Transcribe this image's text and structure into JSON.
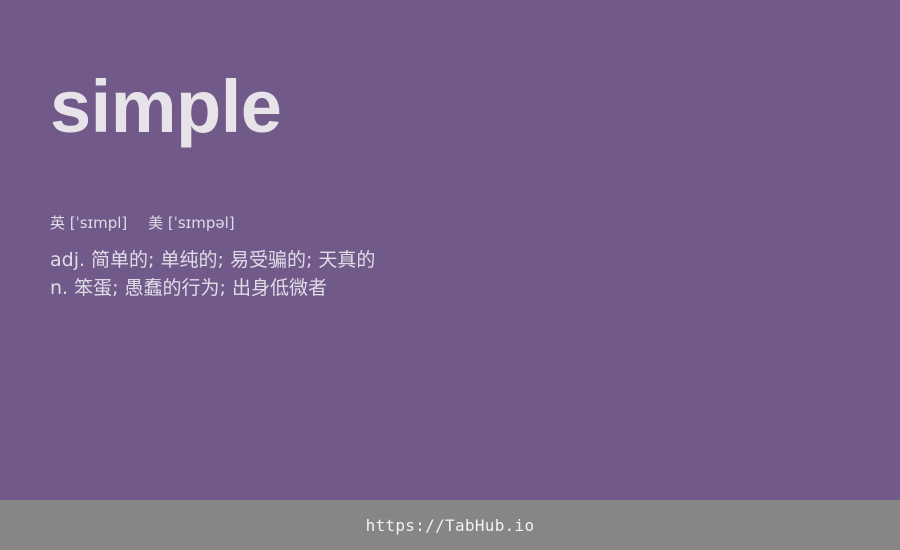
{
  "entry": {
    "word": "simple",
    "phonetics": {
      "uk": "英 [ˈsɪmpl]",
      "us": "美 [ˈsɪmpəl]"
    },
    "definitions": [
      "adj. 简单的; 单纯的; 易受骗的; 天真的",
      "n. 笨蛋; 愚蠢的行为; 出身低微者"
    ]
  },
  "footer": {
    "link_text": "https://TabHub.io"
  },
  "colors": {
    "background": "#71598a",
    "footer_background": "#868686",
    "text": "#e6e4e9"
  }
}
